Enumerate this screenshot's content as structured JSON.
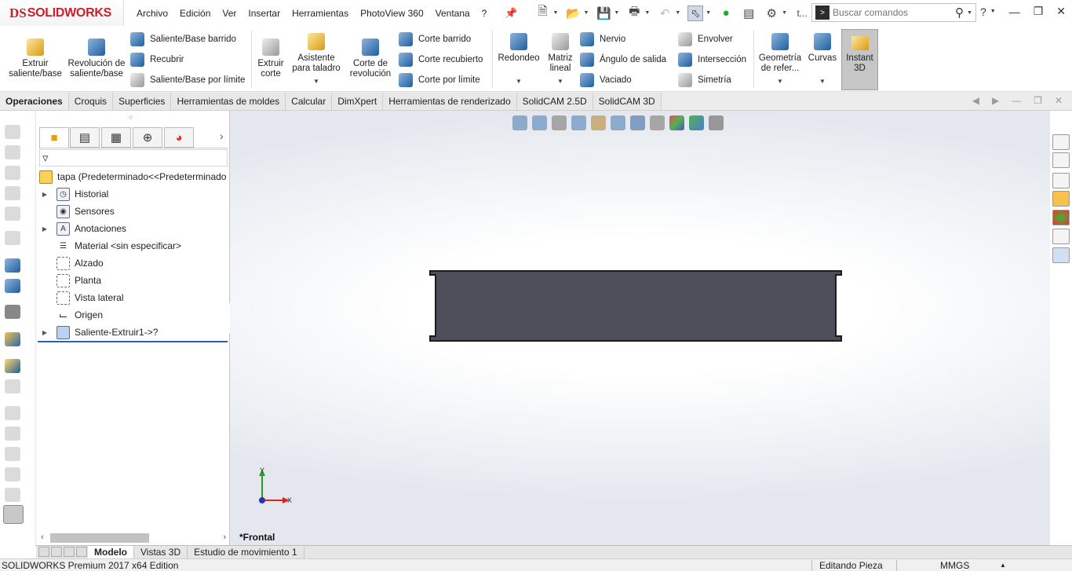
{
  "app": {
    "logo_ds": "DS",
    "logo_name": "SOLIDWORKS"
  },
  "menu": [
    "Archivo",
    "Edición",
    "Ver",
    "Insertar",
    "Herramientas",
    "PhotoView 360",
    "Ventana",
    "?"
  ],
  "search": {
    "placeholder": "Buscar comandos"
  },
  "quick_access_extra": "t...",
  "ribbon": {
    "extruir": "Extruir saliente/base",
    "revolucion": "Revolución de saliente/base",
    "barrido": "Saliente/Base barrido",
    "recubrir": "Recubrir",
    "limite": "Saliente/Base por límite",
    "extruir_corte": "Extruir corte",
    "asistente": "Asistente para taladro",
    "corte_revolucion": "Corte de revolución",
    "corte_barrido": "Corte barrido",
    "corte_recubierto": "Corte recubierto",
    "corte_limite": "Corte por límite",
    "redondeo": "Redondeo",
    "matriz": "Matriz lineal",
    "nervio": "Nervio",
    "angulo": "Ángulo de salida",
    "vaciado": "Vaciado",
    "envolver": "Envolver",
    "interseccion": "Intersección",
    "simetria": "Simetría",
    "geometria": "Geometría de refer...",
    "curvas": "Curvas",
    "instant": "Instant 3D"
  },
  "tabs": [
    "Operaciones",
    "Croquis",
    "Superficies",
    "Herramientas de moldes",
    "Calcular",
    "DimXpert",
    "Herramientas de renderizado",
    "SolidCAM 2.5D",
    "SolidCAM 3D"
  ],
  "active_tab": "Operaciones",
  "tree": {
    "root": "tapa  (Predeterminado<<Predeterminado",
    "items": [
      "Historial",
      "Sensores",
      "Anotaciones",
      "Material <sin especificar>",
      "Alzado",
      "Planta",
      "Vista lateral",
      "Origen",
      "Saliente-Extruir1->?"
    ]
  },
  "viewport": {
    "view_name": "*Frontal",
    "axis_x": "X",
    "axis_y": "Y"
  },
  "bottom_tabs": [
    "Modelo",
    "Vistas 3D",
    "Estudio de movimiento 1"
  ],
  "status": {
    "left": "SOLIDWORKS Premium 2017 x64 Edition",
    "mode": "Editando Pieza",
    "units": "MMGS"
  },
  "colors": {
    "accent": "#c8202a",
    "part": "#4d4f5b",
    "selection_line": "#2b5fb5"
  }
}
